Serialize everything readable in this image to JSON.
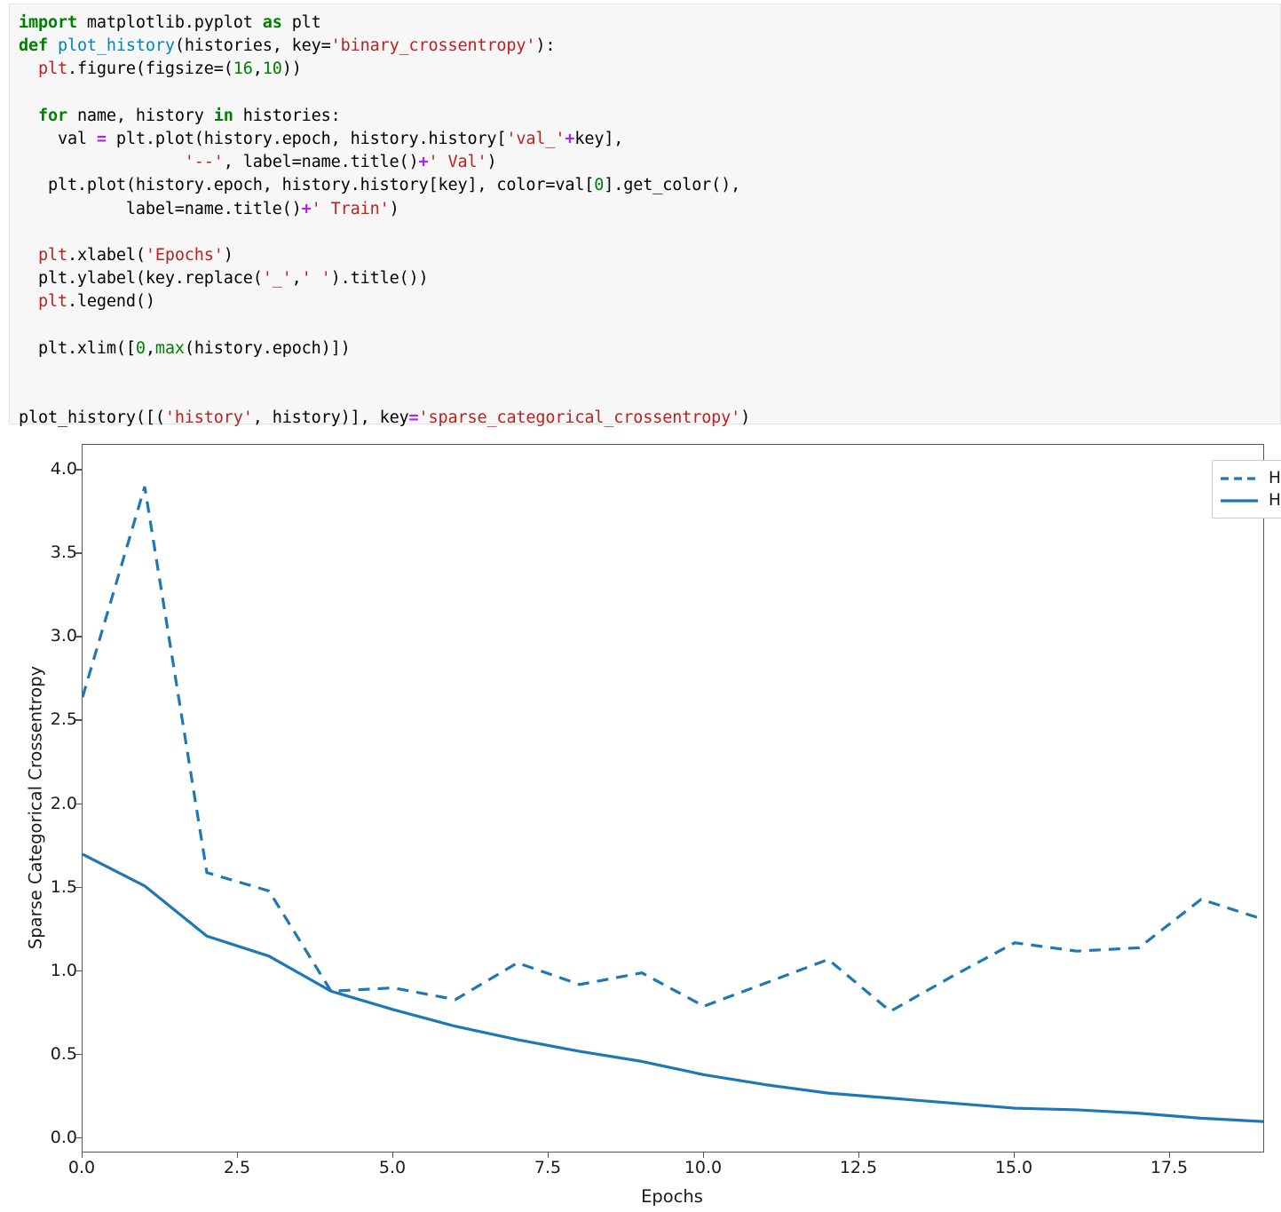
{
  "code_cell": {
    "language": "python",
    "lines": [
      [
        {
          "t": "import",
          "c": "k"
        },
        {
          "t": " matplotlib.pyplot ",
          "c": "pl"
        },
        {
          "t": "as",
          "c": "k"
        },
        {
          "t": " plt",
          "c": "pl"
        }
      ],
      [
        {
          "t": "def",
          "c": "k"
        },
        {
          "t": " ",
          "c": "pl"
        },
        {
          "t": "plot_history",
          "c": "nf"
        },
        {
          "t": "(histories, key=",
          "c": "pl"
        },
        {
          "t": "'binary_crossentropy'",
          "c": "s"
        },
        {
          "t": "):",
          "c": "pl"
        }
      ],
      [
        {
          "t": "  ",
          "c": "pl"
        },
        {
          "t": "plt",
          "c": "n"
        },
        {
          "t": ".figure(figsize=",
          "c": "pl"
        },
        {
          "t": "(",
          "c": "pl"
        },
        {
          "t": "16",
          "c": "num"
        },
        {
          "t": ",",
          "c": "pl"
        },
        {
          "t": "10",
          "c": "num"
        },
        {
          "t": "))",
          "c": "pl"
        }
      ],
      [
        {
          "t": "",
          "c": "pl"
        }
      ],
      [
        {
          "t": "  ",
          "c": "pl"
        },
        {
          "t": "for",
          "c": "k"
        },
        {
          "t": " name, history ",
          "c": "pl"
        },
        {
          "t": "in",
          "c": "k"
        },
        {
          "t": " histories:",
          "c": "pl"
        }
      ],
      [
        {
          "t": "    val ",
          "c": "pl"
        },
        {
          "t": "=",
          "c": "op"
        },
        {
          "t": " plt.plot(history.epoch, history.history[",
          "c": "pl"
        },
        {
          "t": "'val_'",
          "c": "s"
        },
        {
          "t": "+",
          "c": "op"
        },
        {
          "t": "key],",
          "c": "pl"
        }
      ],
      [
        {
          "t": "                 ",
          "c": "pl"
        },
        {
          "t": "'--'",
          "c": "s"
        },
        {
          "t": ", label=name.title()",
          "c": "pl"
        },
        {
          "t": "+",
          "c": "op"
        },
        {
          "t": "' Val'",
          "c": "s"
        },
        {
          "t": ")",
          "c": "pl"
        }
      ],
      [
        {
          "t": "   plt.plot(history.epoch, history.history[key], color=val[",
          "c": "pl"
        },
        {
          "t": "0",
          "c": "num"
        },
        {
          "t": "].get_color(),",
          "c": "pl"
        }
      ],
      [
        {
          "t": "           label=name.title()",
          "c": "pl"
        },
        {
          "t": "+",
          "c": "op"
        },
        {
          "t": "' Train'",
          "c": "s"
        },
        {
          "t": ")",
          "c": "pl"
        }
      ],
      [
        {
          "t": "",
          "c": "pl"
        }
      ],
      [
        {
          "t": "  ",
          "c": "pl"
        },
        {
          "t": "plt",
          "c": "n"
        },
        {
          "t": ".xlabel(",
          "c": "pl"
        },
        {
          "t": "'Epochs'",
          "c": "s"
        },
        {
          "t": ")",
          "c": "pl"
        }
      ],
      [
        {
          "t": "  plt.ylabel(key.replace(",
          "c": "pl"
        },
        {
          "t": "'_'",
          "c": "s"
        },
        {
          "t": ",",
          "c": "pl"
        },
        {
          "t": "' '",
          "c": "s"
        },
        {
          "t": ").title())",
          "c": "pl"
        }
      ],
      [
        {
          "t": "  ",
          "c": "pl"
        },
        {
          "t": "plt",
          "c": "n"
        },
        {
          "t": ".legend()",
          "c": "pl"
        }
      ],
      [
        {
          "t": "",
          "c": "pl"
        }
      ],
      [
        {
          "t": "  plt.xlim([",
          "c": "pl"
        },
        {
          "t": "0",
          "c": "num"
        },
        {
          "t": ",",
          "c": "pl"
        },
        {
          "t": "max",
          "c": "bi"
        },
        {
          "t": "(history.epoch)])",
          "c": "pl"
        }
      ],
      [
        {
          "t": "",
          "c": "pl"
        }
      ],
      [
        {
          "t": "",
          "c": "pl"
        }
      ],
      [
        {
          "t": "plot_history([(",
          "c": "pl"
        },
        {
          "t": "'history'",
          "c": "s"
        },
        {
          "t": ", history)], key",
          "c": "pl"
        },
        {
          "t": "=",
          "c": "op"
        },
        {
          "t": "'sparse_categorical_crossentropy'",
          "c": "s"
        },
        {
          "t": ")",
          "c": "pl"
        }
      ]
    ]
  },
  "chart_data": {
    "type": "line",
    "title": "",
    "xlabel": "Epochs",
    "ylabel": "Sparse Categorical Crossentropy",
    "xlim": [
      0,
      19
    ],
    "ylim": [
      -0.08,
      4.15
    ],
    "grid": false,
    "legend_position": "upper right",
    "xticks": [
      "0.0",
      "2.5",
      "5.0",
      "7.5",
      "10.0",
      "12.5",
      "15.0",
      "17.5"
    ],
    "xtick_values": [
      0,
      2.5,
      5,
      7.5,
      10,
      12.5,
      15,
      17.5
    ],
    "yticks": [
      "0.0",
      "0.5",
      "1.0",
      "1.5",
      "2.0",
      "2.5",
      "3.0",
      "3.5",
      "4.0"
    ],
    "ytick_values": [
      0,
      0.5,
      1.0,
      1.5,
      2.0,
      2.5,
      3.0,
      3.5,
      4.0
    ],
    "x": [
      0,
      1,
      2,
      3,
      4,
      5,
      6,
      7,
      8,
      9,
      10,
      11,
      12,
      13,
      14,
      15,
      16,
      17,
      18,
      19
    ],
    "series": [
      {
        "name": "History Val",
        "style": "dashed",
        "color": "#1f77b4",
        "values": [
          2.64,
          3.9,
          1.59,
          1.48,
          0.88,
          0.9,
          0.83,
          1.05,
          0.92,
          0.99,
          0.79,
          0.93,
          1.07,
          0.76,
          0.97,
          1.17,
          1.12,
          1.14,
          1.43,
          1.31
        ]
      },
      {
        "name": "History Train",
        "style": "solid",
        "color": "#1f77b4",
        "values": [
          1.7,
          1.51,
          1.21,
          1.09,
          0.88,
          0.77,
          0.67,
          0.59,
          0.52,
          0.46,
          0.38,
          0.32,
          0.27,
          0.24,
          0.21,
          0.18,
          0.17,
          0.15,
          0.12,
          0.1
        ]
      }
    ]
  },
  "legend": {
    "entries": [
      {
        "label": "History Val",
        "style": "dashed"
      },
      {
        "label": "History Train",
        "style": "solid"
      }
    ]
  }
}
